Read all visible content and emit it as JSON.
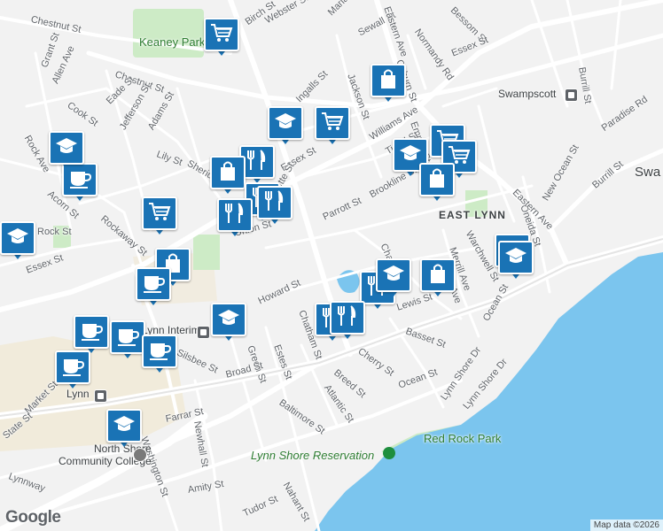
{
  "map": {
    "colors": {
      "land": "#f2f2f2",
      "water": "#7bc5ee",
      "park": "#cdebc6",
      "road": "#ffffff",
      "arterial": "#e4e4e4",
      "pin": "#1a73b5",
      "downtown": "#f0e8d4"
    },
    "street_labels": [
      "Chestnut St",
      "Birch St",
      "Webster St",
      "Marianna St",
      "Sewall St",
      "Eastern Ave",
      "Normandy Rd",
      "Bessom St",
      "Essex St",
      "Grant St",
      "Allen Ave",
      "Chestnut St",
      "Eade St",
      "Cook St",
      "Jefferson St",
      "Adams St",
      "Coburn St",
      "Jackson St",
      "Ingalls St",
      "Burrill St",
      "Rock Ave",
      "Lily St",
      "Sheridan St",
      "Essex St",
      "Williams Ave",
      "Empire St",
      "Tirrell St",
      "Acorn St",
      "Rockaway St",
      "Lafayette St",
      "Brookline St",
      "Parrott St",
      "Rock St",
      "Union St",
      "Oneida St",
      "Eastern Ave",
      "Paradise Rd",
      "Burrill St",
      "New Ocean St",
      "Essex St",
      "Warchwell St",
      "Merrill Ave",
      "Burrill Ave",
      "Chatham St",
      "Howard St",
      "Chatham St",
      "Lewis St",
      "Basset St",
      "Ocean St",
      "Green St",
      "Estes St",
      "Silsbee St",
      "Cherry St",
      "Breed St",
      "Broad St",
      "Atlantic St",
      "Ocean St",
      "Lynn Shore Dr",
      "Market St",
      "State St",
      "Farrar St",
      "Newhall St",
      "Baltimore St",
      "Washington St",
      "Amity St",
      "Lynnway",
      "Nahant St",
      "Tudor St",
      "Lynn Shore Dr"
    ],
    "place_labels": {
      "keaney_park": "Keaney Park",
      "east_lynn": "EAST LYNN",
      "swampscott": "Swampscott",
      "swampscott_town": "Swa",
      "lynn_interim": "Lynn Interim",
      "lynn": "Lynn",
      "north_shore_cc": "North Shore\nCommunity College",
      "red_rock_park": "Red Rock Park",
      "lynn_shore_reservation": "Lynn Shore Reservation"
    },
    "pins": [
      {
        "icon": "shopping-cart-icon"
      },
      {
        "icon": "shopping-bag-icon"
      },
      {
        "icon": "school-icon"
      },
      {
        "icon": "shopping-cart-icon"
      },
      {
        "icon": "coffee-cup-icon"
      },
      {
        "icon": "school-icon"
      },
      {
        "icon": "restaurant-icon"
      },
      {
        "icon": "shopping-bag-icon"
      },
      {
        "icon": "restaurant-icon"
      },
      {
        "icon": "restaurant-icon"
      },
      {
        "icon": "school-icon"
      },
      {
        "icon": "shopping-cart-icon"
      },
      {
        "icon": "shopping-cart-icon"
      },
      {
        "icon": "shopping-bag-icon"
      },
      {
        "icon": "restaurant-icon"
      },
      {
        "icon": "shopping-cart-icon"
      },
      {
        "icon": "school-icon"
      },
      {
        "icon": "shopping-bag-icon"
      },
      {
        "icon": "coffee-cup-icon"
      },
      {
        "icon": "school-icon"
      },
      {
        "icon": "restaurant-icon"
      },
      {
        "icon": "shopping-bag-icon"
      },
      {
        "icon": "coffee-cup-icon"
      },
      {
        "icon": "school-icon"
      },
      {
        "icon": "coffee-cup-icon"
      },
      {
        "icon": "restaurant-icon"
      },
      {
        "icon": "restaurant-icon"
      },
      {
        "icon": "coffee-cup-icon"
      },
      {
        "icon": "coffee-cup-icon"
      },
      {
        "icon": "coffee-cup-icon"
      },
      {
        "icon": "school-icon"
      },
      {
        "icon": "school-icon"
      }
    ]
  },
  "footer": {
    "google": "Google",
    "attribution": "Map data ©2026"
  }
}
